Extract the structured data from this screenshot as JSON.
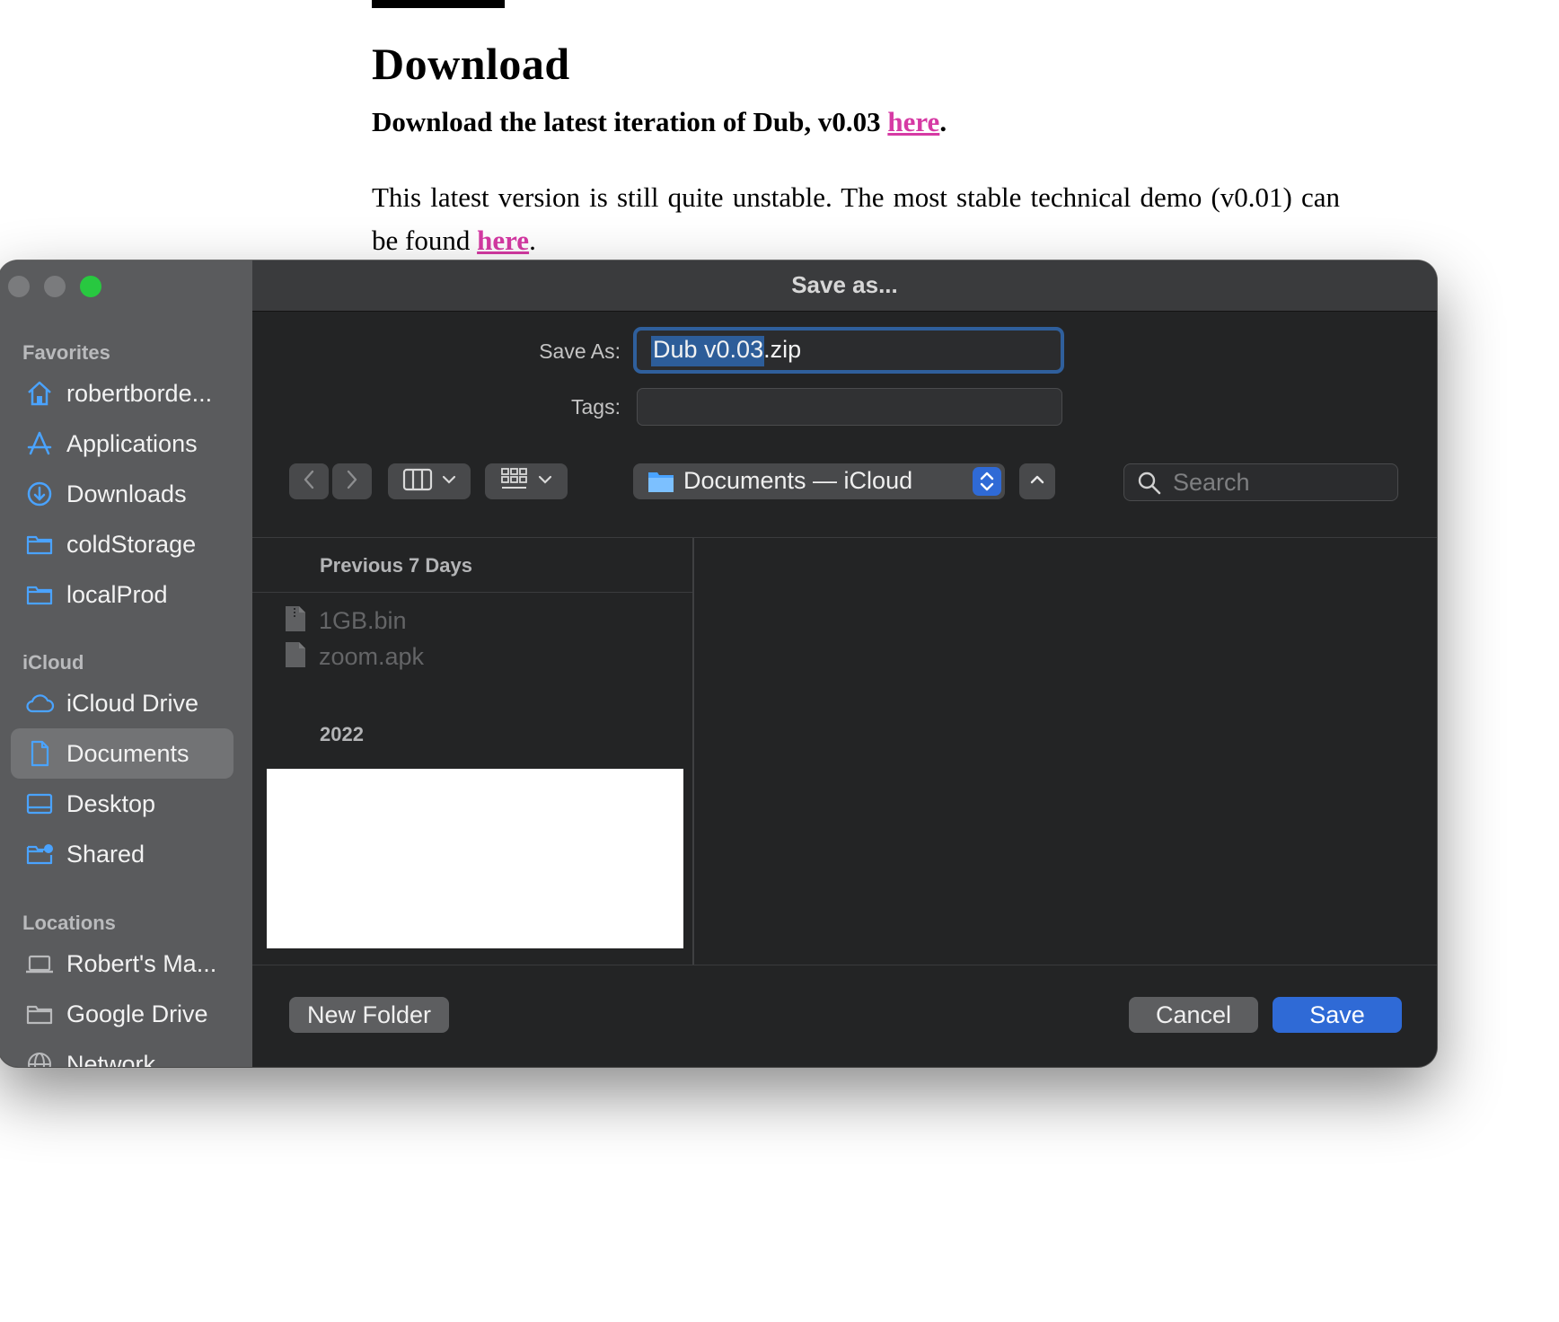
{
  "page": {
    "heading": "Download",
    "subheading_text": "Download the latest iteration of Dub, v0.03 ",
    "subheading_link": "here",
    "subheading_end": ".",
    "para_text": "This latest version is still quite unstable. The most stable technical demo (v0.01) can be found ",
    "para_link": "here",
    "para_end": "."
  },
  "dialog": {
    "title": "Save as...",
    "save_as_label": "Save As:",
    "save_as_value": "Dub v0.03.zip",
    "tags_label": "Tags:",
    "location": "Documents — iCloud",
    "search_placeholder": "Search",
    "new_folder_label": "New Folder",
    "cancel_label": "Cancel",
    "save_label": "Save"
  },
  "sidebar": {
    "favorites_header": "Favorites",
    "favorites": [
      {
        "label": "robertborde...",
        "icon": "home-icon"
      },
      {
        "label": "Applications",
        "icon": "applications-icon"
      },
      {
        "label": "Downloads",
        "icon": "downloads-icon"
      },
      {
        "label": "coldStorage",
        "icon": "folder-icon"
      },
      {
        "label": "localProd",
        "icon": "folder-icon"
      }
    ],
    "icloud_header": "iCloud",
    "icloud": [
      {
        "label": "iCloud Drive",
        "icon": "cloud-icon"
      },
      {
        "label": "Documents",
        "icon": "document-icon",
        "selected": true
      },
      {
        "label": "Desktop",
        "icon": "desktop-icon"
      },
      {
        "label": "Shared",
        "icon": "shared-folder-icon"
      }
    ],
    "locations_header": "Locations",
    "locations": [
      {
        "label": "Robert's Ma...",
        "icon": "laptop-icon"
      },
      {
        "label": "Google Drive",
        "icon": "folder-icon"
      },
      {
        "label": "Network",
        "icon": "network-icon"
      }
    ]
  },
  "browser": {
    "groups": [
      {
        "title": "Previous 7 Days",
        "files": [
          "1GB.bin",
          "zoom.apk"
        ]
      },
      {
        "title": "2022",
        "files": []
      }
    ]
  },
  "colors": {
    "accent": "#2f6ad6",
    "sidebar_icon": "#4aa3ff",
    "link": "#d63aa4",
    "zoom_button": "#28c840"
  }
}
